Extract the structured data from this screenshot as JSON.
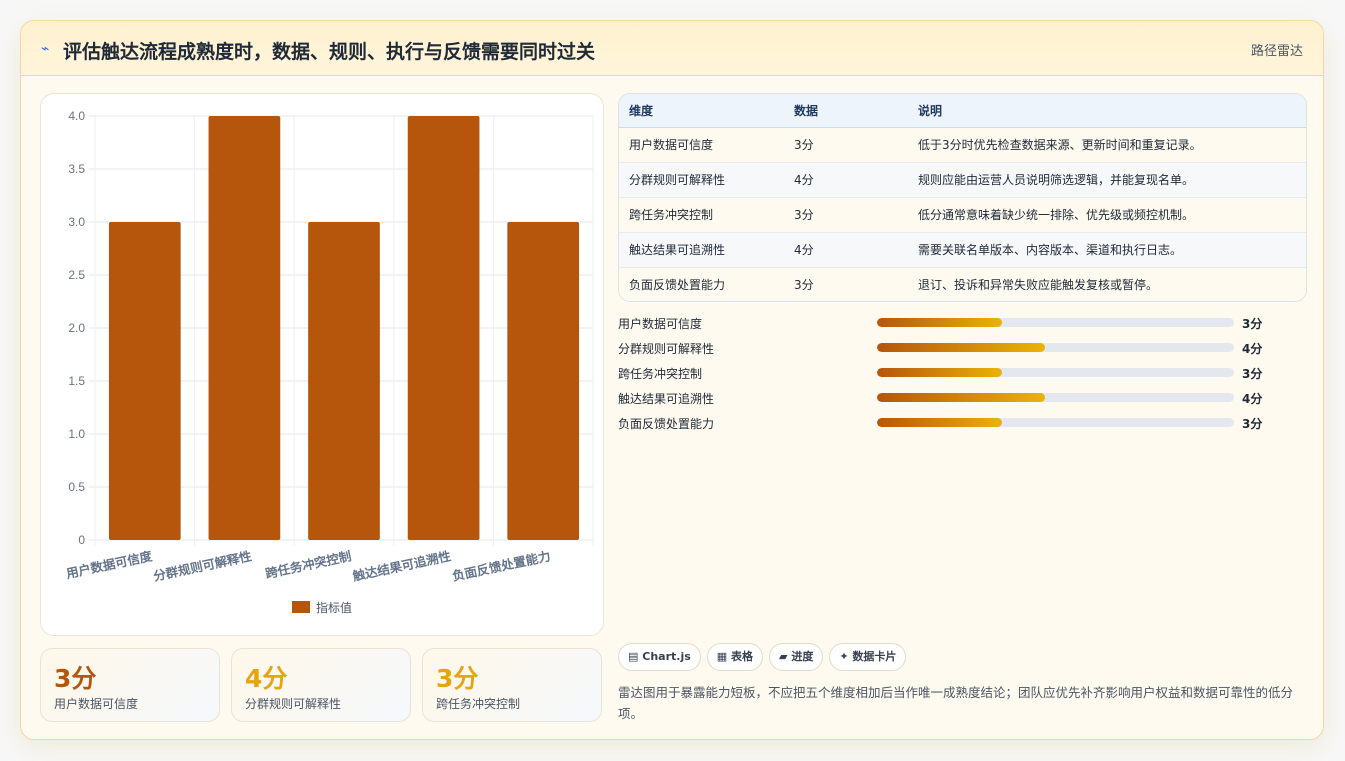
{
  "header": {
    "title": "评估触达流程成熟度时，数据、规则、执行与反馈需要同时过关",
    "title_icon": "trend-icon",
    "badge": "路径雷达"
  },
  "chart_data": {
    "type": "bar",
    "categories": [
      "用户数据可信度",
      "分群规则可解释性",
      "跨任务冲突控制",
      "触达结果可追溯性",
      "负面反馈处置能力"
    ],
    "series": [
      {
        "name": "指标值",
        "values": [
          3,
          4,
          3,
          4,
          3
        ],
        "color": "#b5560c"
      }
    ],
    "y_ticks": [
      "0",
      "0.5",
      "1.0",
      "1.5",
      "2.0",
      "2.5",
      "3.0",
      "3.5",
      "4.0"
    ],
    "ylim": [
      0,
      4
    ],
    "grid": true,
    "legend": "bottom"
  },
  "stats": [
    {
      "value": "3分",
      "label": "用户数据可信度",
      "color": "#b5560c"
    },
    {
      "value": "4分",
      "label": "分群规则可解释性",
      "color": "#e6a312"
    },
    {
      "value": "3分",
      "label": "跨任务冲突控制",
      "color": "#e6a312"
    }
  ],
  "table": {
    "headers": [
      "维度",
      "数据",
      "说明"
    ],
    "rows": [
      {
        "dim": "用户数据可信度",
        "score": "3分",
        "desc": "低于3分时优先检查数据来源、更新时间和重复记录。"
      },
      {
        "dim": "分群规则可解释性",
        "score": "4分",
        "desc": "规则应能由运营人员说明筛选逻辑，并能复现名单。"
      },
      {
        "dim": "跨任务冲突控制",
        "score": "3分",
        "desc": "低分通常意味着缺少统一排除、优先级或频控机制。"
      },
      {
        "dim": "触达结果可追溯性",
        "score": "4分",
        "desc": "需要关联名单版本、内容版本、渠道和执行日志。"
      },
      {
        "dim": "负面反馈处置能力",
        "score": "3分",
        "desc": "退订、投诉和异常失败应能触发复核或暂停。"
      }
    ]
  },
  "progress": [
    {
      "label": "用户数据可信度",
      "value": "3分",
      "fraction": 0.35
    },
    {
      "label": "分群规则可解释性",
      "value": "4分",
      "fraction": 0.47
    },
    {
      "label": "跨任务冲突控制",
      "value": "3分",
      "fraction": 0.35
    },
    {
      "label": "触达结果可追溯性",
      "value": "4分",
      "fraction": 0.47
    },
    {
      "label": "负面反馈处置能力",
      "value": "3分",
      "fraction": 0.35
    }
  ],
  "chips": [
    {
      "icon": "▤",
      "label": "Chart.js"
    },
    {
      "icon": "▦",
      "label": "表格"
    },
    {
      "icon": "▰",
      "label": "进度"
    },
    {
      "icon": "✦",
      "label": "数据卡片"
    }
  ],
  "note": "雷达图用于暴露能力短板，不应把五个维度相加后当作唯一成熟度结论；团队应优先补齐影响用户权益和数据可靠性的低分项。"
}
